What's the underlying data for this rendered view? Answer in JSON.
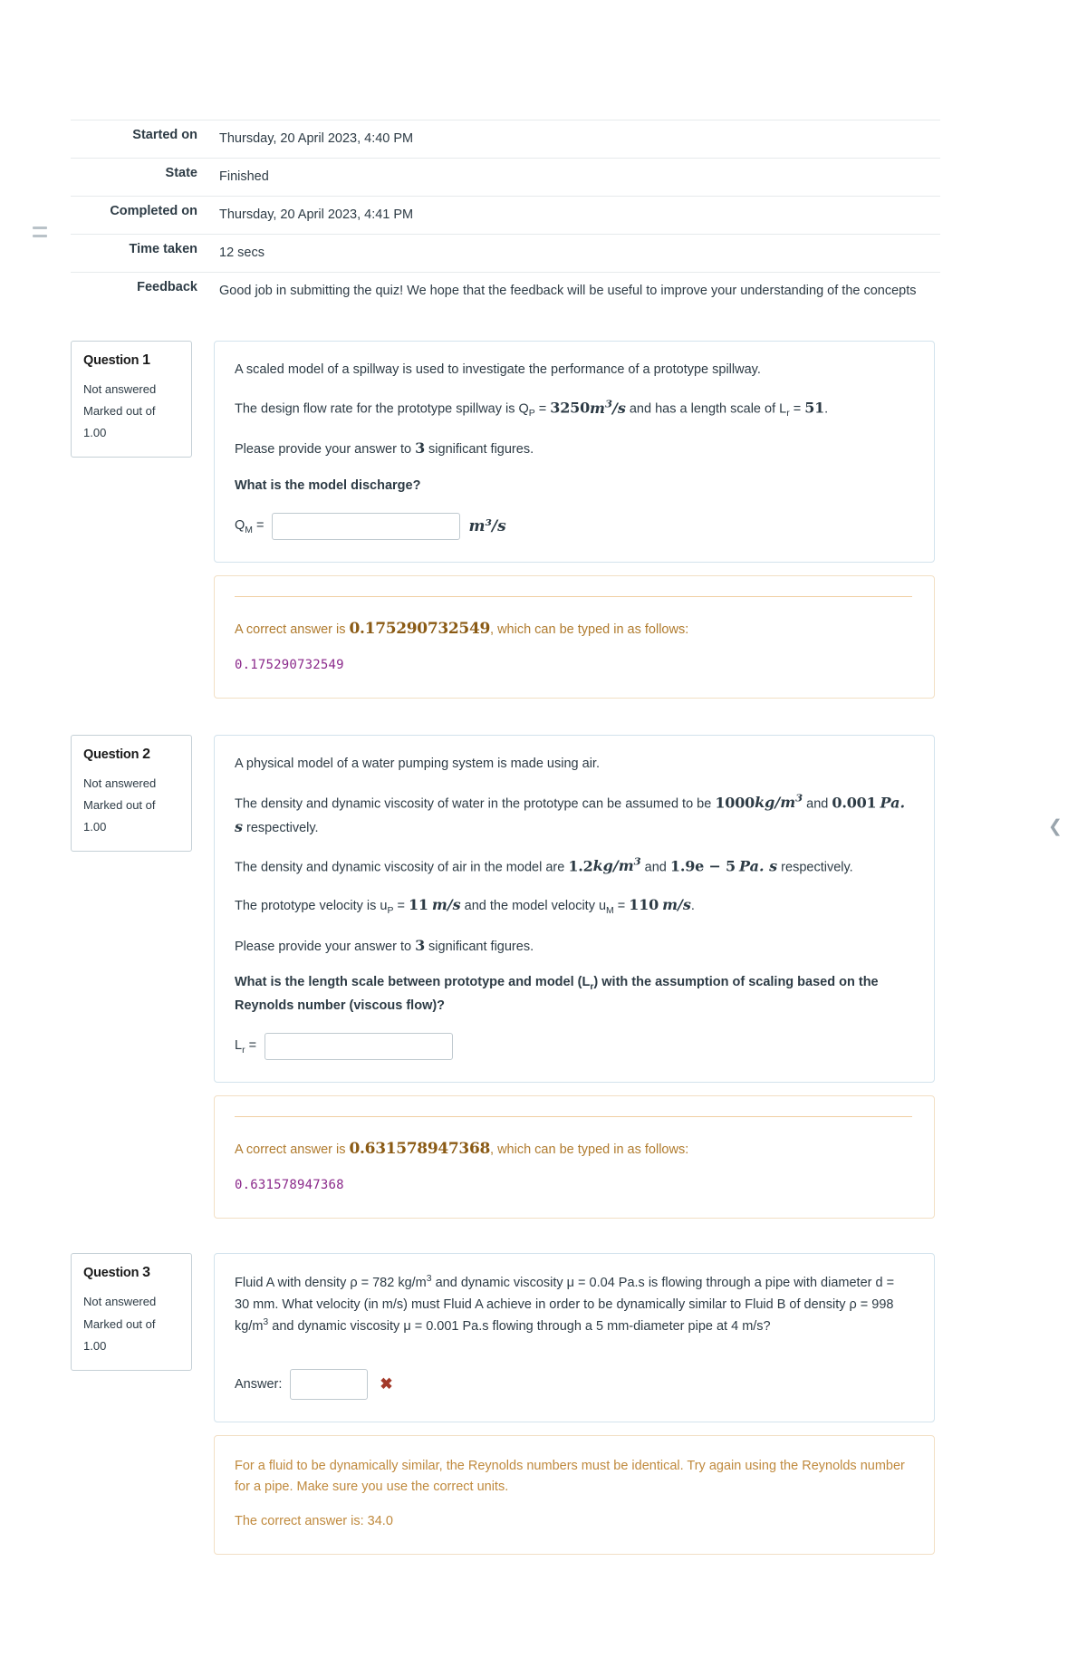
{
  "summary": {
    "rows": [
      {
        "label": "Started on",
        "value": "Thursday, 20 April 2023, 4:40 PM"
      },
      {
        "label": "State",
        "value": "Finished"
      },
      {
        "label": "Completed on",
        "value": "Thursday, 20 April 2023, 4:41 PM"
      },
      {
        "label": "Time taken",
        "value": "12 secs"
      },
      {
        "label": "Feedback",
        "value": "Good job in submitting the quiz! We hope that the feedback will be useful to improve your understanding of the concepts"
      }
    ]
  },
  "questions": [
    {
      "info": {
        "word": "Question",
        "number": "1",
        "state": "Not answered",
        "marks": "Marked out of 1.00"
      },
      "body": {
        "p1": "A scaled model of a spillway is used to investigate the performance of a prototype spillway.",
        "p2_pre": "The design flow rate for the prototype spillway is Q",
        "p2_sub": "P",
        "p2_eq": " = ",
        "p2_val": "3250",
        "p2_unit": "m",
        "p2_unit_sup": "3",
        "p2_unit_den": "/s",
        "p2_mid": " and has a length scale of L",
        "p2_sub2": "r",
        "p2_eq2": " = ",
        "p2_val2": "51",
        "p2_end": ".",
        "p3_pre": "Please provide your answer to ",
        "p3_val": "3",
        "p3_post": " significant figures.",
        "prompt": "What is the model discharge?",
        "answer_label": "Q",
        "answer_label_sub": "M",
        "answer_eq": " =",
        "answer_value": "",
        "answer_unit": "m³/s"
      },
      "feedback": {
        "lead": "A correct answer is ",
        "value": "0.175290732549",
        "trail": ", which can be typed in as follows:",
        "mono": "0.175290732549"
      }
    },
    {
      "info": {
        "word": "Question",
        "number": "2",
        "state": "Not answered",
        "marks": "Marked out of 1.00"
      },
      "body": {
        "p1": "A physical model of a water pumping system is made using air.",
        "p2_pre": "The density and dynamic viscosity of water in the prototype can be assumed to be ",
        "p2_v1": "1000",
        "p2_u1": "kg/m",
        "p2_u1_sup": "3",
        "p2_mid": " and ",
        "p2_v2": "0.001",
        "p2_u2": "Pa. s",
        "p2_post": " respectively.",
        "p3_pre": "The density and dynamic viscosity of air in the model are ",
        "p3_v1": "1.2",
        "p3_u1": "kg/m",
        "p3_u1_sup": "3",
        "p3_mid": " and ",
        "p3_v2": "1.9e − 5",
        "p3_u2": "Pa. s",
        "p3_post": " respectively.",
        "p4_pre": "The prototype velocity is u",
        "p4_sub1": "P",
        "p4_eq1": " = ",
        "p4_v1": "11",
        "p4_u1": "m/s",
        "p4_mid": " and the model velocity u",
        "p4_sub2": "M",
        "p4_eq2": " = ",
        "p4_v2": "110",
        "p4_u2": "m/s",
        "p4_end": ".",
        "p5_pre": "Please provide your answer to ",
        "p5_val": "3",
        "p5_post": " significant figures.",
        "prompt_a": "What is the length scale between prototype and model (L",
        "prompt_sub": "r",
        "prompt_b": ") with the assumption of scaling based on the Reynolds number (viscous flow)?",
        "answer_label": "L",
        "answer_label_sub": "r",
        "answer_eq": " =",
        "answer_value": ""
      },
      "feedback": {
        "lead": "A correct answer is ",
        "value": "0.631578947368",
        "trail": ", which can be typed in as follows:",
        "mono": "0.631578947368"
      }
    },
    {
      "info": {
        "word": "Question",
        "number": "3",
        "state": "Not answered",
        "marks": "Marked out of 1.00"
      },
      "body": {
        "text_a": "Fluid A with density ρ = 782 kg/m",
        "sup_a": "3",
        "text_b": " and dynamic viscosity μ = 0.04 Pa.s is flowing through a pipe with diameter d = 30 mm. What velocity (in m/s) must Fluid A achieve in order to be dynamically similar to Fluid B of density ρ = 998 kg/m",
        "sup_b": "3",
        "text_c": " and dynamic viscosity μ = 0.001 Pa.s flowing through a 5 mm-diameter pipe at 4 m/s?",
        "answer_label": "Answer:",
        "answer_value": "",
        "status_icon": "cross-icon"
      },
      "feedback": {
        "line1": "For a fluid to be dynamically similar, the Reynolds numbers must be identical. Try again using the Reynolds number for a pipe. Make sure you use the correct units.",
        "line2": "The correct answer is: 34.0"
      }
    }
  ]
}
